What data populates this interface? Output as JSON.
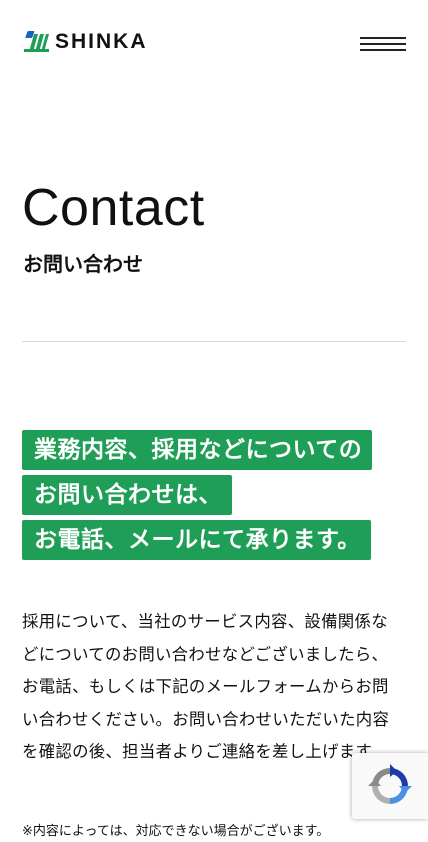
{
  "header": {
    "logo_text": "SHINKA"
  },
  "page": {
    "title": "Contact",
    "subtitle": "お問い合わせ"
  },
  "lead": {
    "lines": [
      "業務内容、採用などについての",
      "お問い合わせは、",
      "お電話、メールにて承ります。"
    ]
  },
  "body_text": "採用について、当社のサービス内容、設備関係などについてのお問い合わせなどございましたら、お電話、もしくは下記のメールフォームからお問い合わせください。お問い合わせいただいた内容を確認の後、担当者よりご連絡を差し上げます。",
  "note": "※内容によっては、対応できない場合がございます。",
  "colors": {
    "accent": "#1f9e57",
    "logo_blue": "#1565c0",
    "logo_green": "#1f9e57",
    "text": "#111111",
    "divider": "#d9d9d9"
  }
}
